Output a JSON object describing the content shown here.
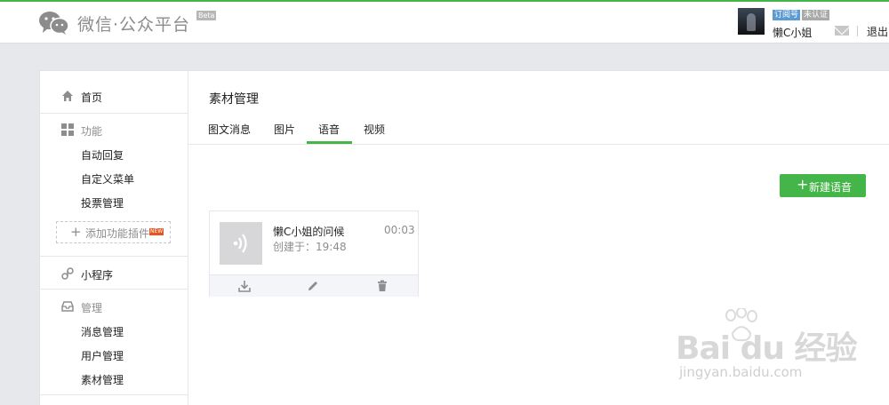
{
  "header": {
    "logo_text": "微信·公众平台",
    "beta": "Beta",
    "account_type_tag": "订阅号",
    "verify_tag": "未认证",
    "username": "懒C小姐",
    "logout": "退出"
  },
  "sidebar": {
    "home": "首页",
    "features": {
      "label": "功能",
      "items": [
        "自动回复",
        "自定义菜单",
        "投票管理"
      ],
      "add_plugin": "添加功能插件",
      "new_badge": "NEW"
    },
    "miniprogram": "小程序",
    "manage": {
      "label": "管理",
      "items": [
        "消息管理",
        "用户管理",
        "素材管理"
      ]
    }
  },
  "main": {
    "title": "素材管理",
    "tabs": [
      {
        "label": "图文消息",
        "active": false
      },
      {
        "label": "图片",
        "active": false
      },
      {
        "label": "语音",
        "active": true
      },
      {
        "label": "视频",
        "active": false
      }
    ],
    "new_button": "新建语音",
    "voice_items": [
      {
        "name": "懒C小姐的问候",
        "duration": "00:03",
        "created": "创建于：19:48"
      }
    ]
  },
  "watermark": {
    "text": "Bai du 经验",
    "url": "jingyan.baidu.com"
  },
  "colors": {
    "accent_green": "#44b549",
    "tag_blue": "#5b9bd5",
    "tag_gray": "#a9a9a9"
  }
}
